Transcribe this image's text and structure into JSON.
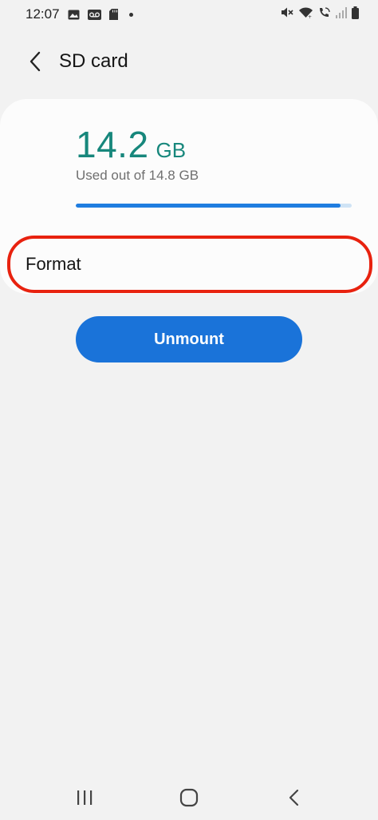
{
  "status_bar": {
    "time": "12:07",
    "left_icons": [
      "gallery-icon",
      "voicemail-icon",
      "sd-card-icon"
    ],
    "right_icons": [
      "mute-icon",
      "wifi-icon",
      "wifi-calling-icon",
      "signal-icon",
      "battery-icon"
    ]
  },
  "header": {
    "title": "SD card",
    "back_icon": "back-arrow-icon"
  },
  "storage": {
    "used_value": "14.2",
    "used_unit": "GB",
    "subtitle": "Used out of 14.8 GB",
    "used_fraction": 0.96,
    "bar_color": "#1f7de0",
    "accent_color": "#17877c"
  },
  "format_item": {
    "label": "Format",
    "highlight_color": "#e8220f"
  },
  "unmount_button": {
    "label": "Unmount",
    "color": "#1a73d9"
  },
  "nav_bar": {
    "items": [
      "recent-apps-icon",
      "home-icon",
      "back-icon"
    ]
  }
}
